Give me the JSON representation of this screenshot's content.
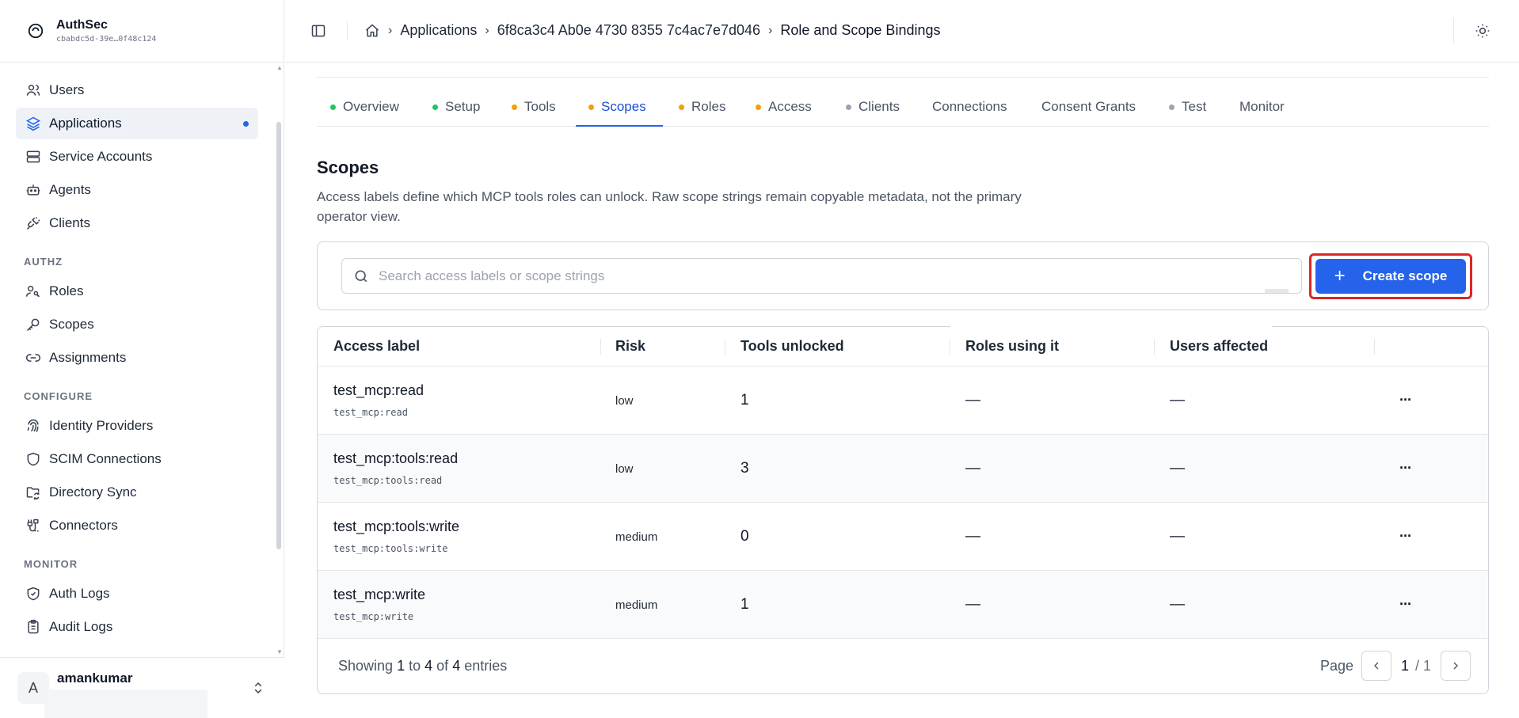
{
  "brand": {
    "name": "AuthSec",
    "tenant_id": "cbabdc5d-39e…0f48c124"
  },
  "sidebar": {
    "items_top": [
      {
        "label": "Users",
        "icon": "users-icon"
      },
      {
        "label": "Applications",
        "icon": "layers-icon",
        "active": true
      },
      {
        "label": "Service Accounts",
        "icon": "server-icon"
      },
      {
        "label": "Agents",
        "icon": "bot-icon"
      },
      {
        "label": "Clients",
        "icon": "plug-icon"
      }
    ],
    "sections": {
      "authz": "AUTHZ",
      "configure": "CONFIGURE",
      "monitor": "MONITOR"
    },
    "authz_items": [
      {
        "label": "Roles",
        "icon": "user-key-icon"
      },
      {
        "label": "Scopes",
        "icon": "key-icon"
      },
      {
        "label": "Assignments",
        "icon": "link-icon"
      }
    ],
    "configure_items": [
      {
        "label": "Identity Providers",
        "icon": "fingerprint-icon"
      },
      {
        "label": "SCIM Connections",
        "icon": "shield-icon"
      },
      {
        "label": "Directory Sync",
        "icon": "folder-sync-icon"
      },
      {
        "label": "Connectors",
        "icon": "cable-icon"
      }
    ],
    "monitor_items": [
      {
        "label": "Auth Logs",
        "icon": "shield-check-icon"
      },
      {
        "label": "Audit Logs",
        "icon": "clipboard-icon"
      }
    ],
    "user": {
      "initial": "A",
      "name": "amankumar"
    }
  },
  "topbar": {
    "breadcrumbs": [
      "Applications",
      "6f8ca3c4 Ab0e 4730 8355 7c4ac7e7d046",
      "Role and Scope Bindings"
    ]
  },
  "tabs": [
    {
      "label": "Overview",
      "dot": "#22c55e"
    },
    {
      "label": "Setup",
      "dot": "#22c55e"
    },
    {
      "label": "Tools",
      "dot": "#f59e0b"
    },
    {
      "label": "Scopes",
      "dot": "#f59e0b",
      "active": true
    },
    {
      "label": "Roles",
      "dot": "#f59e0b"
    },
    {
      "label": "Access",
      "dot": "#f59e0b"
    },
    {
      "label": "Clients",
      "dot": "#9ca3af"
    },
    {
      "label": "Connections",
      "dot": null
    },
    {
      "label": "Consent Grants",
      "dot": null
    },
    {
      "label": "Test",
      "dot": "#9ca3af"
    },
    {
      "label": "Monitor",
      "dot": null
    }
  ],
  "scopes": {
    "title": "Scopes",
    "description": "Access labels define which MCP tools roles can unlock. Raw scope strings remain copyable metadata, not the primary operator view.",
    "search_placeholder": "Search access labels or scope strings",
    "search_value": "",
    "create_label": "Create scope",
    "create_icon": "plus-icon"
  },
  "table": {
    "headers": [
      "Access label",
      "Risk",
      "Tools unlocked",
      "Roles using it",
      "Users affected"
    ],
    "rows": [
      {
        "label": "test_mcp:read",
        "code": "test_mcp:read",
        "risk": "low",
        "tools": "1",
        "roles": "—",
        "users": "—",
        "more": "···"
      },
      {
        "label": "test_mcp:tools:read",
        "code": "test_mcp:tools:read",
        "risk": "low",
        "tools": "3",
        "roles": "—",
        "users": "—",
        "more": "···"
      },
      {
        "label": "test_mcp:tools:write",
        "code": "test_mcp:tools:write",
        "risk": "medium",
        "tools": "0",
        "roles": "—",
        "users": "—",
        "more": "···"
      },
      {
        "label": "test_mcp:write",
        "code": "test_mcp:write",
        "risk": "medium",
        "tools": "1",
        "roles": "—",
        "users": "—",
        "more": "···"
      }
    ],
    "footer": {
      "showing_prefix": "Showing",
      "from": "1",
      "to_word": "to",
      "to": "4",
      "of_word": "of",
      "total": "4",
      "entries_word": "entries",
      "page_label": "Page",
      "page": "1",
      "page_total": "/ 1"
    }
  },
  "colors": {
    "accent": "#2563eb",
    "highlight_border": "#dc2626"
  }
}
